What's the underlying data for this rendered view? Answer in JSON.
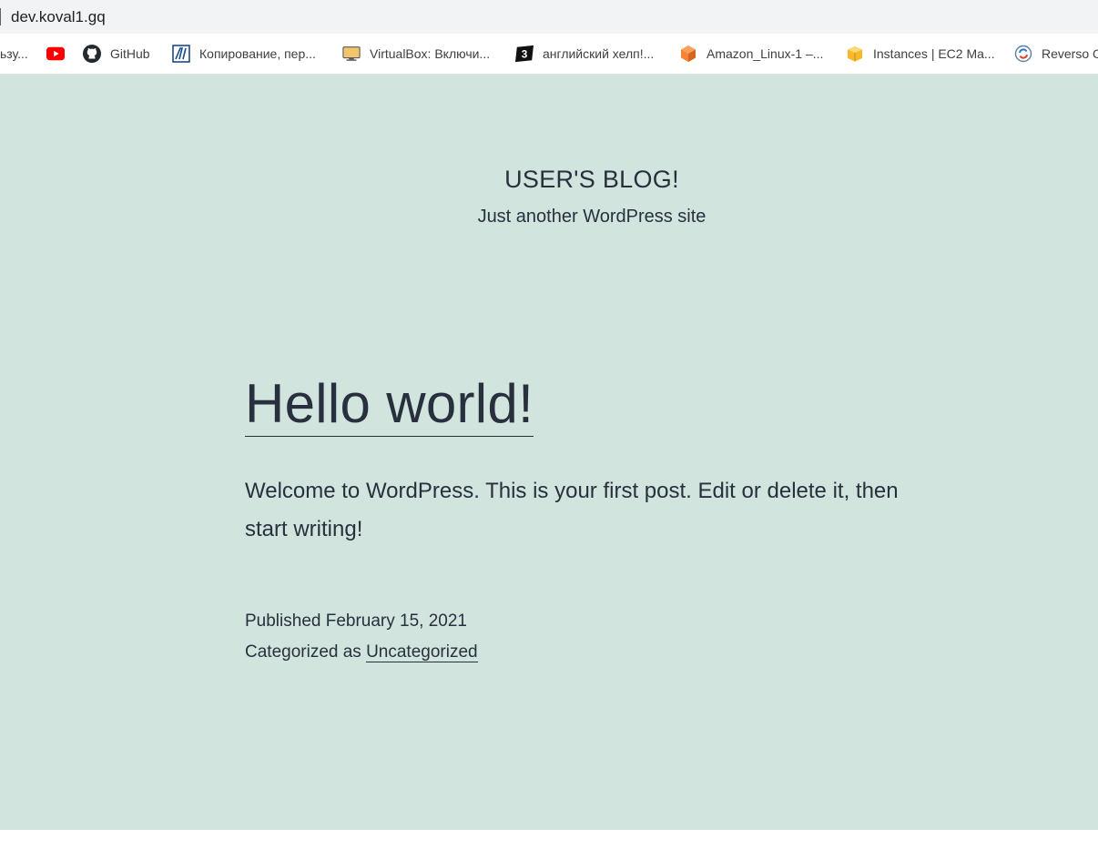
{
  "address_bar": {
    "url": "dev.koval1.gq"
  },
  "bookmarks": [
    {
      "label": "ьзу...",
      "icon": "none"
    },
    {
      "label": "",
      "icon": "youtube-icon"
    },
    {
      "label": "GitHub",
      "icon": "github-icon"
    },
    {
      "label": "Копирование, пер...",
      "icon": "chart-line-icon"
    },
    {
      "label": "VirtualBox: Включи...",
      "icon": "monitor-icon"
    },
    {
      "label": "английский хелп!...",
      "icon": "number-three-icon"
    },
    {
      "label": "Amazon_Linux-1 –...",
      "icon": "orange-cube-icon"
    },
    {
      "label": "Instances | EC2 Ma...",
      "icon": "box-icon"
    },
    {
      "label": "Reverso C",
      "icon": "reverso-icon"
    }
  ],
  "site": {
    "title": "USER'S BLOG!",
    "description": "Just another WordPress site"
  },
  "post": {
    "title": "Hello world!",
    "body": "Welcome to WordPress. This is your first post. Edit or delete it, then start writing!",
    "published_label": "Published February 15, 2021",
    "categorized_prefix": "Categorized as ",
    "category": "Uncategorized"
  },
  "colors": {
    "page_background": "#d1e4dd",
    "text": "#28303d",
    "youtube_red": "#ff0000"
  }
}
